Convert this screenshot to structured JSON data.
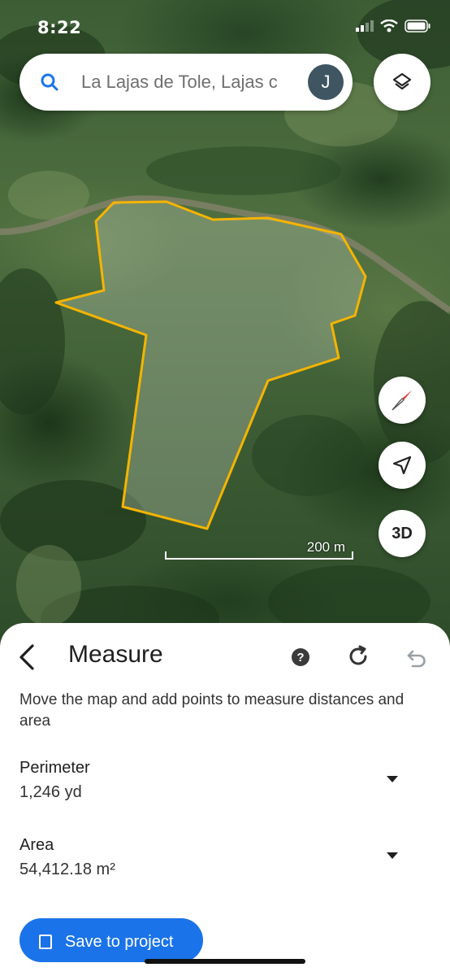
{
  "status": {
    "time": "8:22"
  },
  "search": {
    "text": "La Lajas de Tole, Lajas c",
    "avatar_initial": "J"
  },
  "map": {
    "scale_label": "200 m",
    "three_d_label": "3D"
  },
  "measure": {
    "title": "Measure",
    "description": "Move the map and add points to measure distances and area",
    "perimeter_label": "Perimeter",
    "perimeter_value": "1,246 yd",
    "area_label": "Area",
    "area_value": "54,412.18 m²",
    "save_label": "Save to project"
  },
  "colors": {
    "polygon": "#f5b400",
    "accent": "#1a73e8"
  }
}
